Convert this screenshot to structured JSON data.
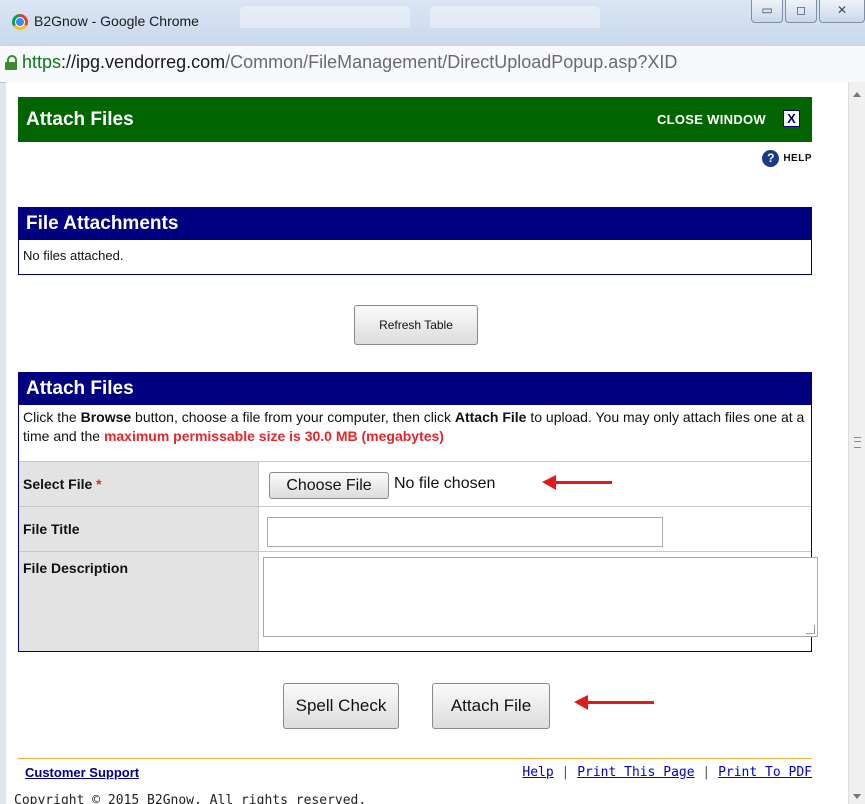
{
  "window": {
    "title": "B2Gnow - Google Chrome",
    "controls": {
      "minimize": "▭",
      "maximize": "◻",
      "close": "✕"
    }
  },
  "address": {
    "protocol": "https",
    "host": "://ipg.vendorreg.com",
    "path": "/Common/FileManagement/DirectUploadPopup.asp?XID"
  },
  "header": {
    "title": "Attach Files",
    "close_label": "CLOSE WINDOW",
    "close_icon": "X",
    "help_icon": "?",
    "help_label": "HELP"
  },
  "attachments": {
    "heading": "File Attachments",
    "empty_text": "No files attached.",
    "refresh_label": "Refresh Table"
  },
  "attach": {
    "heading": "Attach Files",
    "instr_1": "Click the ",
    "instr_browse": "Browse",
    "instr_2": " button, choose a file from your computer, then click ",
    "instr_attach": "Attach File",
    "instr_3": " to upload. You may only attach files one at a time and the ",
    "instr_max": "maximum permissable size is 30.0 MB (megabytes)",
    "select_label": "Select File",
    "required_mark": "*",
    "choose_label": "Choose File",
    "no_file_text": "No file chosen",
    "title_label": "File Title",
    "title_value": "",
    "desc_label": "File Description",
    "desc_value": ""
  },
  "actions": {
    "spell_check": "Spell Check",
    "attach_file": "Attach File"
  },
  "footer": {
    "support": "Customer Support",
    "help": "Help",
    "separator": "|",
    "print_page": "Print This Page",
    "print_pdf": "Print To PDF",
    "copyright": "Copyright © 2015 B2Gnow. All rights reserved."
  },
  "colors": {
    "header_green": "#006400",
    "section_navy": "#000080",
    "required_red": "#e4262a",
    "annotation_red": "#e01b1b"
  }
}
